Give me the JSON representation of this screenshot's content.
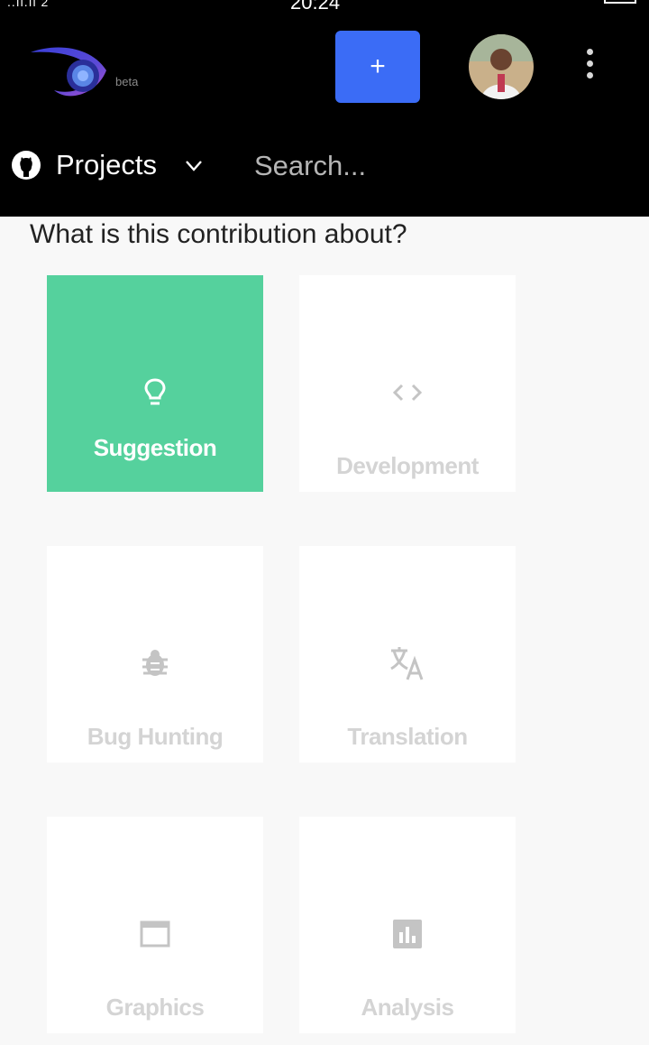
{
  "status_bar": {
    "signal": "..ıl.ıl 2",
    "time": "20:24"
  },
  "header": {
    "beta_label": "beta",
    "add_button_label": "+",
    "projects_label": "Projects",
    "search_placeholder": "Search..."
  },
  "main": {
    "question": "What is this contribution about?",
    "categories": [
      {
        "label": "Suggestion",
        "icon": "lightbulb-icon",
        "selected": true
      },
      {
        "label": "Development",
        "icon": "code-icon",
        "selected": false
      },
      {
        "label": "Bug Hunting",
        "icon": "bug-icon",
        "selected": false
      },
      {
        "label": "Translation",
        "icon": "translate-icon",
        "selected": false
      },
      {
        "label": "Graphics",
        "icon": "window-icon",
        "selected": false
      },
      {
        "label": "Analysis",
        "icon": "bar-chart-icon",
        "selected": false
      }
    ]
  },
  "colors": {
    "header_bg": "#000000",
    "accent_blue": "#3b6cf6",
    "selected_green": "#55d19d",
    "inactive_text": "#d4d4d4"
  }
}
